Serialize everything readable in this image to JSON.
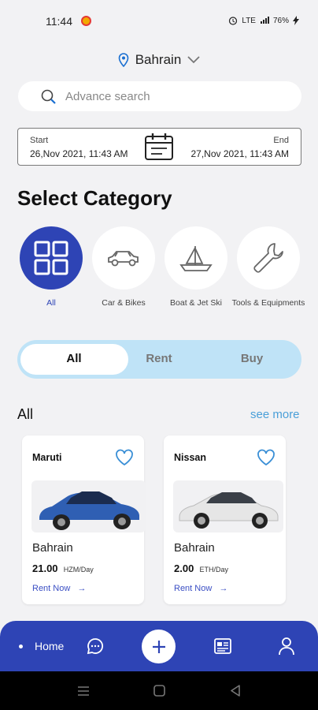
{
  "status_bar": {
    "time": "11:44",
    "signal": "LTE",
    "battery": "76%"
  },
  "location": {
    "name": "Bahrain"
  },
  "search": {
    "placeholder": "Advance search"
  },
  "date_range": {
    "start_label": "Start",
    "start_value": "26,Nov 2021, 11:43 AM",
    "end_label": "End",
    "end_value": "27,Nov 2021, 11:43 AM"
  },
  "category_section": {
    "title": "Select Category",
    "items": [
      {
        "label": "All",
        "icon": "grid-icon",
        "active": true
      },
      {
        "label": "Car & Bikes",
        "icon": "car-icon",
        "active": false
      },
      {
        "label": "Boat & Jet Ski",
        "icon": "boat-icon",
        "active": false
      },
      {
        "label": "Tools & Equipments",
        "icon": "wrench-icon",
        "active": false
      }
    ]
  },
  "filter_toggle": {
    "options": [
      "All",
      "Rent",
      "Buy"
    ],
    "selected": "All"
  },
  "listing": {
    "title": "All",
    "see_more": "see more",
    "cards": [
      {
        "brand": "Maruti",
        "location": "Bahrain",
        "price": "21.00",
        "unit": "HZM/Day",
        "cta": "Rent Now",
        "car_color": "#2f5fb3"
      },
      {
        "brand": "Nissan",
        "location": "Bahrain",
        "price": "2.00",
        "unit": "ETH/Day",
        "cta": "Rent Now",
        "car_color": "#e6e6e6"
      }
    ]
  },
  "bottom_nav": {
    "home_label": "Home"
  },
  "colors": {
    "accent": "#2e44b5",
    "toggle_bg": "#bfe3f7",
    "link": "#4a9fd8"
  }
}
